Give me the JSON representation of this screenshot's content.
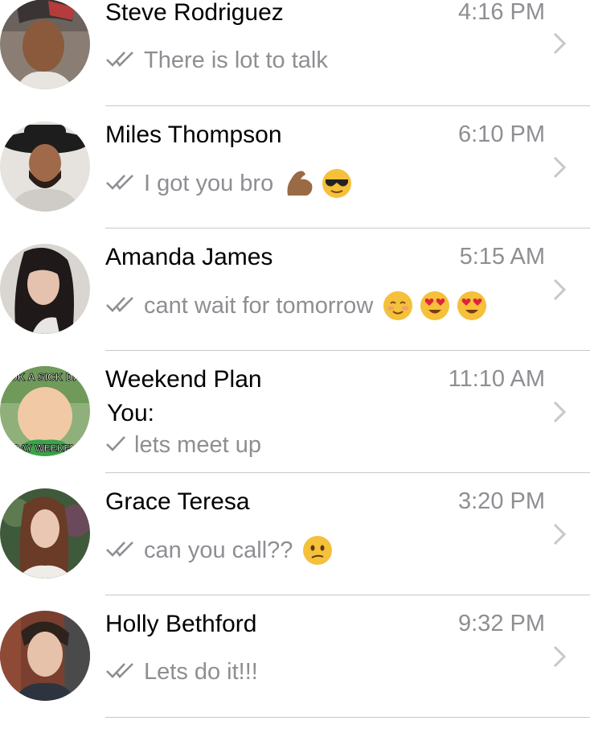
{
  "chats": [
    {
      "name": "Steve Rodriguez",
      "time": "4:16 PM",
      "message": "There is lot to talk",
      "status": "double-check",
      "emojis": []
    },
    {
      "name": "Miles Thompson",
      "time": "6:10 PM",
      "message": "I got you bro",
      "status": "double-check",
      "emojis": [
        "flexed-biceps-emoji",
        "sunglasses-face-emoji"
      ]
    },
    {
      "name": "Amanda James",
      "time": "5:15 AM",
      "message": "cant wait for tomorrow",
      "status": "double-check",
      "emojis": [
        "smiling-face-emoji",
        "heart-eyes-emoji",
        "heart-eyes-emoji"
      ]
    },
    {
      "name": "Weekend Plan",
      "time": "11:10 AM",
      "sender": "You:",
      "message": "lets meet up",
      "status": "single-check",
      "emojis": [],
      "avatar_text_top": "OK A SICK DA",
      "avatar_text_bottom": "DAY WEEKEN"
    },
    {
      "name": "Grace Teresa",
      "time": "3:20 PM",
      "message": "can you call??",
      "status": "double-check",
      "emojis": [
        "confused-face-emoji"
      ]
    },
    {
      "name": "Holly Bethford",
      "time": "9:32 PM",
      "message": "Lets do it!!!",
      "status": "double-check",
      "emojis": []
    }
  ],
  "colors": {
    "separator": "#c8c7cc",
    "secondary_text": "#8e8e93",
    "primary_text": "#000000"
  }
}
